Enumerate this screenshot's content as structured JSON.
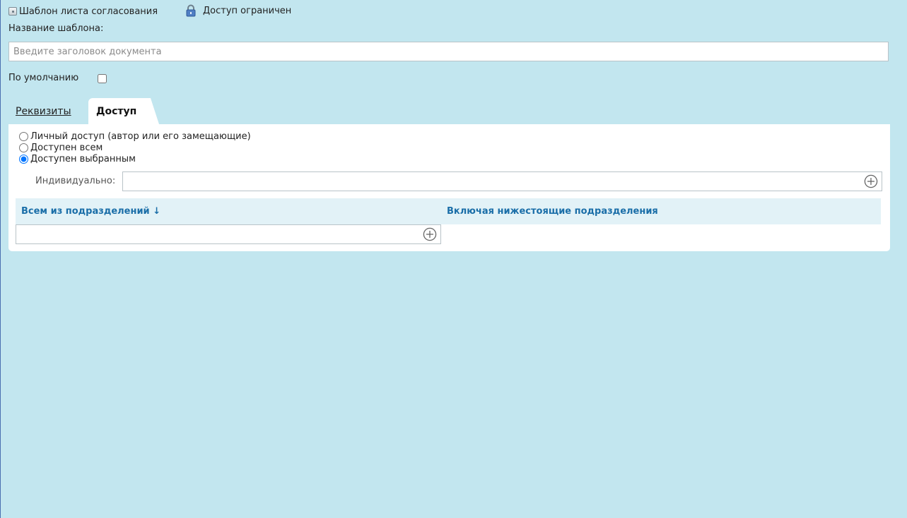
{
  "header": {
    "doc_type": "Шаблон листа согласования",
    "access_status": "Доступ ограничен"
  },
  "form": {
    "name_label": "Название шаблона:",
    "name_placeholder": "Введите заголовок документа",
    "name_value": "",
    "default_label": "По умолчанию",
    "default_checked": false
  },
  "tabs": [
    {
      "label": "Реквизиты",
      "active": false
    },
    {
      "label": "Доступ",
      "active": true
    }
  ],
  "access": {
    "options": [
      {
        "label": "Личный доступ (автор или его замещающие)",
        "selected": false
      },
      {
        "label": "Доступен всем",
        "selected": false
      },
      {
        "label": "Доступен выбранным",
        "selected": true
      }
    ],
    "individual_label": "Индивидуально:",
    "departments": {
      "col1_header": "Всем из подразделений ↓",
      "col2_header": "Включая нижестоящие подразделения"
    }
  },
  "colors": {
    "background": "#c2e6ef",
    "panel": "#ffffff",
    "header_band": "#e2f2f7",
    "link_blue": "#1a6ea8"
  }
}
